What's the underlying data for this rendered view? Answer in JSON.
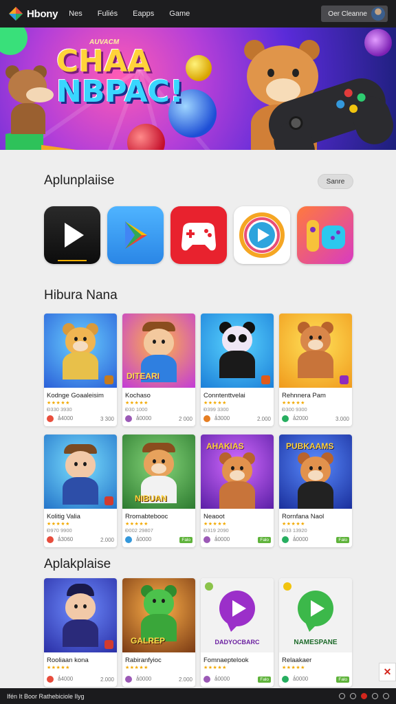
{
  "header": {
    "brand": "Hbony",
    "nav": [
      "Nes",
      "Fuliés",
      "Eapps",
      "Game"
    ],
    "account_label": "Oer Cleanne"
  },
  "hero": {
    "kicker": "AUVACM",
    "title_line1": "CHAA",
    "title_line2": "NBPAC!"
  },
  "sections": {
    "apps_title": "Aplunplaiise",
    "see_all": "Sanre",
    "featured_title": "Hibura Nana",
    "more_title": "Aplakplaise"
  },
  "app_icons": [
    "play-icon",
    "play-store-icon",
    "gamepad-icon",
    "play-circle-icon",
    "controller-icon"
  ],
  "featured_cards": [
    {
      "name": "Kodnge Goaaleisim",
      "stars": "★★★★★",
      "meta": "Ð330 3930",
      "foot_left": "ǻ4000",
      "foot_right": "3 300"
    },
    {
      "name": "Kochaso",
      "stars": "★★★★★",
      "meta": "Ð30 1000",
      "foot_left": "ǻ0000",
      "foot_right": "2 000"
    },
    {
      "name": "Conntenttvelai",
      "stars": "★★★★★",
      "meta": "Ð399 3300",
      "foot_left": "ǻ3000",
      "foot_right": "2.000"
    },
    {
      "name": "Rehnnera Pam",
      "stars": "★★★★★",
      "meta": "Ð300 9300",
      "foot_left": "ǻ2000",
      "foot_right": "3.000"
    },
    {
      "name": "Kolitig Valia",
      "stars": "★★★★★",
      "meta": "Ð970 9900",
      "foot_left": "ǻ3060",
      "foot_right": "2.000"
    },
    {
      "name": "Rromabtebooc",
      "stars": "★★★★★",
      "meta": "Ð002 29807",
      "foot_left": "ǻ0000",
      "foot_right": "Falo"
    },
    {
      "name": "Neaoot",
      "stars": "★★★★★",
      "meta": "Ð319 2090",
      "foot_left": "ǻ0000",
      "foot_right": "Falo"
    },
    {
      "name": "Rornfana Naol",
      "stars": "★★★★★",
      "meta": "Ð33 13920",
      "foot_left": "ǻ0000",
      "foot_right": "Falo"
    }
  ],
  "more_cards": [
    {
      "name": "Rooliaan kona",
      "stars": "★★★★★",
      "meta": "",
      "foot_left": "ǻ4000",
      "foot_right": "2.000",
      "art_text": ""
    },
    {
      "name": "Rabiranfyioc",
      "stars": "★★★★★",
      "meta": "",
      "foot_left": "ǻ0000",
      "foot_right": "2.000",
      "art_text": "GALREP"
    },
    {
      "name": "Fomnaeptelook",
      "stars": "★★★★★",
      "meta": "",
      "foot_left": "ǻ0000",
      "foot_right": "Falo",
      "art_text": "DADYOCBARC"
    },
    {
      "name": "Relaakaer",
      "stars": "★★★★★",
      "meta": "",
      "foot_left": "ǻ0000",
      "foot_right": "Falo",
      "art_text": "NAMESPANE"
    }
  ],
  "featured_art_text": [
    "",
    "DITEARI",
    "",
    "",
    "",
    "NIBUAN",
    "AHAKIAS",
    "PUBKAAMS"
  ],
  "bottom": {
    "text": "Ifén It Boor Rathebiciole Ilyg"
  },
  "colors": {
    "accent_red": "#d3261d",
    "star": "#f2a900",
    "topbar": "#1d1d1f"
  }
}
